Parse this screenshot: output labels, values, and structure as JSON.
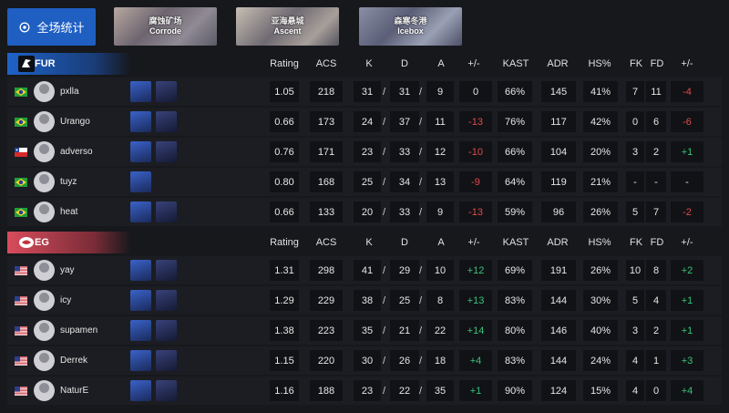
{
  "topbar": {
    "overall_label": "全场统计",
    "maps": [
      {
        "cn": "腐蚀矿场",
        "en": "Corrode"
      },
      {
        "cn": "亚海悬城",
        "en": "Ascent"
      },
      {
        "cn": "森寒冬港",
        "en": "Icebox"
      }
    ]
  },
  "columns": [
    "Rating",
    "ACS",
    "K",
    "D",
    "A",
    "+/-",
    "KAST",
    "ADR",
    "HS%",
    "FK",
    "FD",
    "+/-"
  ],
  "teams": [
    {
      "name": "FUR",
      "players": [
        {
          "name": "pxlla",
          "flag": "BR",
          "rating": "1.05",
          "acs": "218",
          "k": "31",
          "d": "31",
          "a": "9",
          "pm": "0",
          "kast": "66%",
          "adr": "145",
          "hs": "41%",
          "fk": "7",
          "fd": "11",
          "fpm": "-4"
        },
        {
          "name": "Urango",
          "flag": "BR",
          "rating": "0.66",
          "acs": "173",
          "k": "24",
          "d": "37",
          "a": "11",
          "pm": "-13",
          "kast": "76%",
          "adr": "117",
          "hs": "42%",
          "fk": "0",
          "fd": "6",
          "fpm": "-6"
        },
        {
          "name": "adverso",
          "flag": "CL",
          "rating": "0.76",
          "acs": "171",
          "k": "23",
          "d": "33",
          "a": "12",
          "pm": "-10",
          "kast": "66%",
          "adr": "104",
          "hs": "20%",
          "fk": "3",
          "fd": "2",
          "fpm": "+1"
        },
        {
          "name": "tuyz",
          "flag": "BR",
          "rating": "0.80",
          "acs": "168",
          "k": "25",
          "d": "34",
          "a": "13",
          "pm": "-9",
          "kast": "64%",
          "adr": "119",
          "hs": "21%",
          "fk": "-",
          "fd": "-",
          "fpm": "-"
        },
        {
          "name": "heat",
          "flag": "BR",
          "rating": "0.66",
          "acs": "133",
          "k": "20",
          "d": "33",
          "a": "9",
          "pm": "-13",
          "kast": "59%",
          "adr": "96",
          "hs": "26%",
          "fk": "5",
          "fd": "7",
          "fpm": "-2"
        }
      ]
    },
    {
      "name": "EG",
      "players": [
        {
          "name": "yay",
          "flag": "US",
          "rating": "1.31",
          "acs": "298",
          "k": "41",
          "d": "29",
          "a": "10",
          "pm": "+12",
          "kast": "69%",
          "adr": "191",
          "hs": "26%",
          "fk": "10",
          "fd": "8",
          "fpm": "+2"
        },
        {
          "name": "icy",
          "flag": "US",
          "rating": "1.29",
          "acs": "229",
          "k": "38",
          "d": "25",
          "a": "8",
          "pm": "+13",
          "kast": "83%",
          "adr": "144",
          "hs": "30%",
          "fk": "5",
          "fd": "4",
          "fpm": "+1"
        },
        {
          "name": "supamen",
          "flag": "US",
          "rating": "1.38",
          "acs": "223",
          "k": "35",
          "d": "21",
          "a": "22",
          "pm": "+14",
          "kast": "80%",
          "adr": "146",
          "hs": "40%",
          "fk": "3",
          "fd": "2",
          "fpm": "+1"
        },
        {
          "name": "Derrek",
          "flag": "US",
          "rating": "1.15",
          "acs": "220",
          "k": "30",
          "d": "26",
          "a": "18",
          "pm": "+4",
          "kast": "83%",
          "adr": "144",
          "hs": "24%",
          "fk": "4",
          "fd": "1",
          "fpm": "+3"
        },
        {
          "name": "NaturE",
          "flag": "US",
          "rating": "1.16",
          "acs": "188",
          "k": "23",
          "d": "22",
          "a": "35",
          "pm": "+1",
          "kast": "90%",
          "adr": "124",
          "hs": "15%",
          "fk": "4",
          "fd": "0",
          "fpm": "+4"
        }
      ]
    }
  ],
  "colors": {
    "accent_blue": "#1f5fc2",
    "team_fur": "#1e62c8",
    "team_eg": "#d84c5c",
    "negative": "#e04a4a",
    "positive": "#38c27a"
  }
}
